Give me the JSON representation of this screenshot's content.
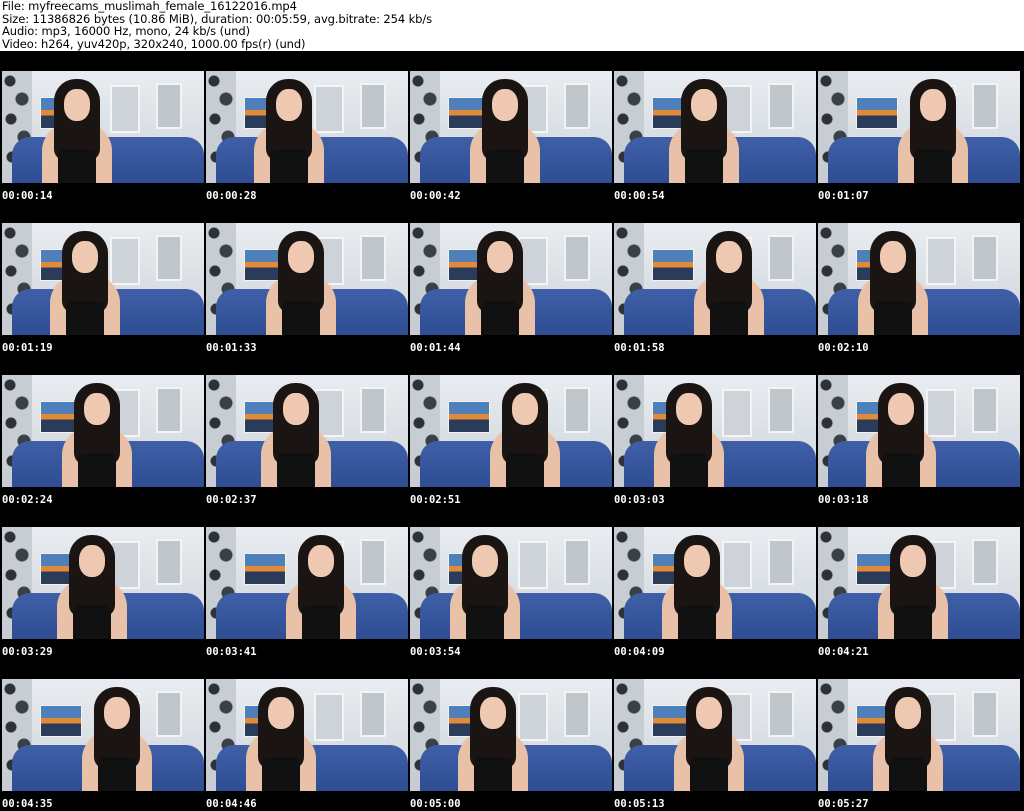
{
  "header": {
    "file": "File: myfreecams_muslimah_female_16122016.mp4",
    "size": "Size: 11386826 bytes (10.86 MiB), duration: 00:05:59, avg.bitrate: 254 kb/s",
    "audio": "Audio: mp3, 16000 Hz, mono, 24 kb/s (und)",
    "video": "Video: h264, yuv420p, 320x240, 1000.00 fps(r) (und)"
  },
  "thumbnails": [
    [
      "00:00:14",
      "00:00:28",
      "00:00:42",
      "00:00:54",
      "00:01:07"
    ],
    [
      "00:01:19",
      "00:01:33",
      "00:01:44",
      "00:01:58",
      "00:02:10"
    ],
    [
      "00:02:24",
      "00:02:37",
      "00:02:51",
      "00:03:03",
      "00:03:18"
    ],
    [
      "00:03:29",
      "00:03:41",
      "00:03:54",
      "00:04:09",
      "00:04:21"
    ],
    [
      "00:04:35",
      "00:04:46",
      "00:05:00",
      "00:05:13",
      "00:05:27"
    ]
  ]
}
